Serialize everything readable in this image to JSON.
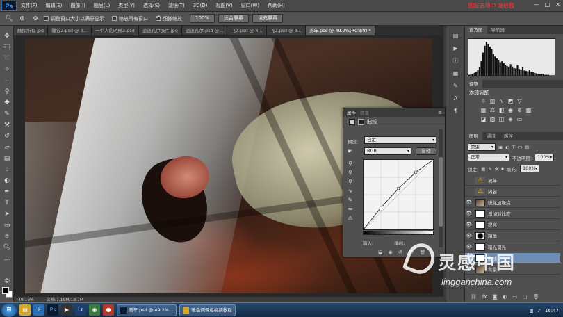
{
  "app": {
    "logo": "Ps",
    "note": "图层选项中 发给我"
  },
  "menu": [
    "文件(F)",
    "编辑(E)",
    "图像(I)",
    "图层(L)",
    "类型(Y)",
    "选择(S)",
    "滤镜(T)",
    "3D(D)",
    "视图(V)",
    "窗口(W)",
    "帮助(H)"
  ],
  "window_controls": [
    "—",
    "□",
    "✕"
  ],
  "options": {
    "resize_windows_label": "调整窗口大小以满屏显示",
    "resize_windows_checked": false,
    "zoom_all_label": "缩放所有窗口",
    "zoom_all_checked": false,
    "scrubby_zoom_label": "细微缩放",
    "scrubby_zoom_checked": true,
    "btn_100": "100%",
    "btn_fit": "适合屏幕",
    "btn_fill": "填充屏幕"
  },
  "tabs": [
    {
      "label": "触探所有.jpg",
      "active": false
    },
    {
      "label": "馨谷2.psd @ 3...",
      "active": false
    },
    {
      "label": "一个人的时候2.psd",
      "active": false
    },
    {
      "label": "遗逝孔尔服片.jpg",
      "active": false
    },
    {
      "label": "遗逝孔尔.psd @...",
      "active": false
    },
    {
      "label": "飞2.psd @ 4...",
      "active": false
    },
    {
      "label": "飞2.psd @ 3...",
      "active": false
    },
    {
      "label": "流年.psd @ 49.2%(RGB/8) *",
      "active": true
    }
  ],
  "status": {
    "zoom": "49.16%",
    "doc": "文档:7.19M/18.7M"
  },
  "curves": {
    "tab_props": "属性",
    "tab_info": "信息",
    "title": "曲线",
    "preset_label": "预设:",
    "preset_value": "自定",
    "channel_value": "RGB",
    "auto_label": "自动",
    "input_label": "输入:",
    "output_label": "输出:"
  },
  "curve_points": [
    [
      0,
      0
    ],
    [
      64,
      80
    ],
    [
      128,
      150
    ],
    [
      192,
      210
    ],
    [
      255,
      255
    ]
  ],
  "panels": {
    "histogram_tab": "直方图",
    "navigator_tab": "导航器",
    "adjust_tab": "调整",
    "adjust_add": "添加调整",
    "layers_tab": "图层",
    "channels_tab": "通道",
    "paths_tab": "路径",
    "kind_label": "类型",
    "blend_mode": "正常",
    "opacity_label": "不透明度:",
    "opacity_value": "100%",
    "lock_label": "锁定:",
    "fill_label": "填充:",
    "fill_value": "100%"
  },
  "histogram": [
    2,
    3,
    4,
    6,
    8,
    12,
    18,
    30,
    48,
    62,
    70,
    66,
    60,
    55,
    45,
    40,
    36,
    32,
    28,
    30,
    26,
    22,
    20,
    18,
    24,
    19,
    16,
    15,
    22,
    14,
    12,
    18,
    11,
    10,
    9,
    12,
    8,
    7,
    6,
    5,
    4,
    4,
    3,
    3,
    2,
    2,
    2,
    1,
    1,
    1
  ],
  "layers": [
    {
      "name": "流年",
      "thumb": "warning",
      "visible": false,
      "selected": false
    },
    {
      "name": "内容",
      "thumb": "warning",
      "visible": false,
      "selected": false
    },
    {
      "name": "锐化加噪点",
      "thumb": "photo",
      "visible": true,
      "selected": false
    },
    {
      "name": "增加对比度",
      "thumb": "white",
      "visible": true,
      "selected": false
    },
    {
      "name": "提亮",
      "thumb": "white",
      "visible": true,
      "selected": false
    },
    {
      "name": "暗角",
      "thumb": "dark",
      "visible": true,
      "selected": false
    },
    {
      "name": "暗光调亮",
      "thumb": "white",
      "visible": true,
      "selected": false
    },
    {
      "name": "曲线 1",
      "thumb": "white",
      "visible": true,
      "selected": true
    },
    {
      "name": "背景",
      "thumb": "photo",
      "visible": true,
      "selected": false
    }
  ],
  "taskbar": {
    "tasks": [
      "流年.psd @ 49.2%...",
      "暖色调调色视频教程"
    ],
    "clock": "16:47"
  },
  "watermark": {
    "cn": "灵感中国",
    "en": "lingganchina.com"
  }
}
